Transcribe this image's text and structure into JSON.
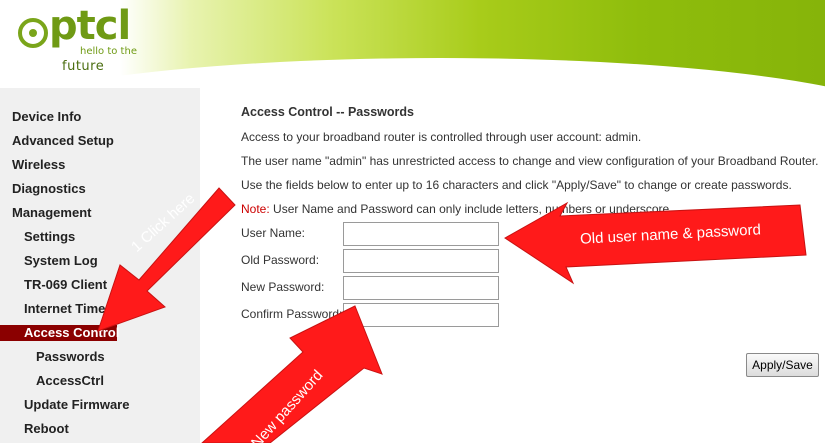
{
  "header": {
    "logo_word": "ptcl",
    "logo_tagline_1": "hello to the",
    "logo_tagline_2": "future"
  },
  "sidebar": {
    "items": [
      {
        "label": "Device Info",
        "level": 0
      },
      {
        "label": "Advanced Setup",
        "level": 0
      },
      {
        "label": "Wireless",
        "level": 0
      },
      {
        "label": "Diagnostics",
        "level": 0
      },
      {
        "label": "Management",
        "level": 0
      },
      {
        "label": "Settings",
        "level": 1
      },
      {
        "label": "System Log",
        "level": 1
      },
      {
        "label": "TR-069 Client",
        "level": 1
      },
      {
        "label": "Internet Time",
        "level": 1
      },
      {
        "label": "Access Control",
        "level": 1,
        "active": true
      },
      {
        "label": "Passwords",
        "level": 2
      },
      {
        "label": "AccessCtrl",
        "level": 2
      },
      {
        "label": "Update Firmware",
        "level": 1
      },
      {
        "label": "Reboot",
        "level": 1
      }
    ]
  },
  "main": {
    "title": "Access Control -- Passwords",
    "para1": "Access to your broadband router is controlled through user account: admin.",
    "para2": "The user name \"admin\" has unrestricted access to change and view configuration of your Broadband Router.",
    "para3": "Use the fields below to enter up to 16 characters and click \"Apply/Save\" to change or create passwords.",
    "note_label": "Note:",
    "note_text": " User Name and Password can only include letters, numbers or underscore.",
    "fields": {
      "username": {
        "label": "User Name:",
        "value": ""
      },
      "old_password": {
        "label": "Old Password:",
        "value": ""
      },
      "new_password": {
        "label": "New Password:",
        "value": ""
      },
      "confirm_password": {
        "label": "Confirm Password:",
        "value": ""
      }
    },
    "apply_label": "Apply/Save"
  },
  "annotations": {
    "click_here": "1 Click here",
    "old_user": "Old user name & password",
    "new_password": "New password",
    "arrow_color": "#ff1a1a"
  }
}
